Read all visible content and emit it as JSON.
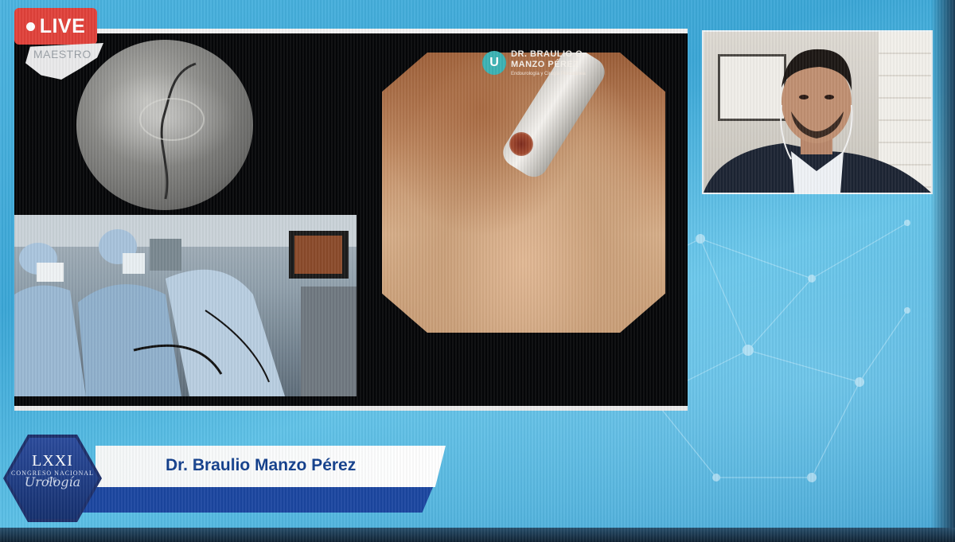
{
  "live_badge": {
    "label": "LIVE"
  },
  "overlay": {
    "maestro_label": "MAESTRO"
  },
  "endoscope": {
    "brand_logo_letter": "U",
    "brand_line1": "DR. BRAULIO O.",
    "brand_line2": "MANZO PÉREZ",
    "brand_sub": "Endourología y Cirugía Percutánea"
  },
  "lower_third": {
    "speaker_name": "Dr. Braulio Manzo Pérez",
    "congress_number": "LXXI",
    "congress_line": "CONGRESO NACIONAL DE",
    "congress_script": "Urología"
  },
  "colors": {
    "live": "#e0413a",
    "name_text": "#123f8c",
    "name_strip": "#1b46a0",
    "background": "#3aa6d6"
  }
}
